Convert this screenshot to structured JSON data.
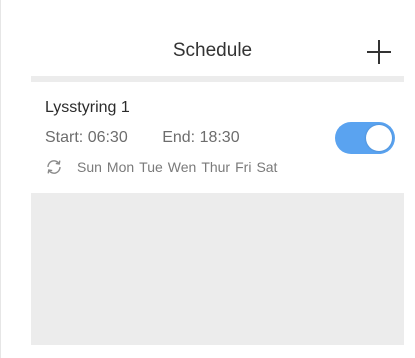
{
  "header": {
    "title": "Schedule",
    "add_icon": "plus-icon"
  },
  "schedules": [
    {
      "name": "Lysstyring 1",
      "start_label": "Start:",
      "start_time": "06:30",
      "end_label": "End:",
      "end_time": "18:30",
      "repeat_icon": "repeat-icon",
      "days": [
        "Sun",
        "Mon",
        "Tue",
        "Wen",
        "Thur",
        "Fri",
        "Sat"
      ],
      "enabled": true
    }
  ],
  "colors": {
    "toggle_on": "#5aa3f0",
    "empty_background": "#ececec"
  }
}
